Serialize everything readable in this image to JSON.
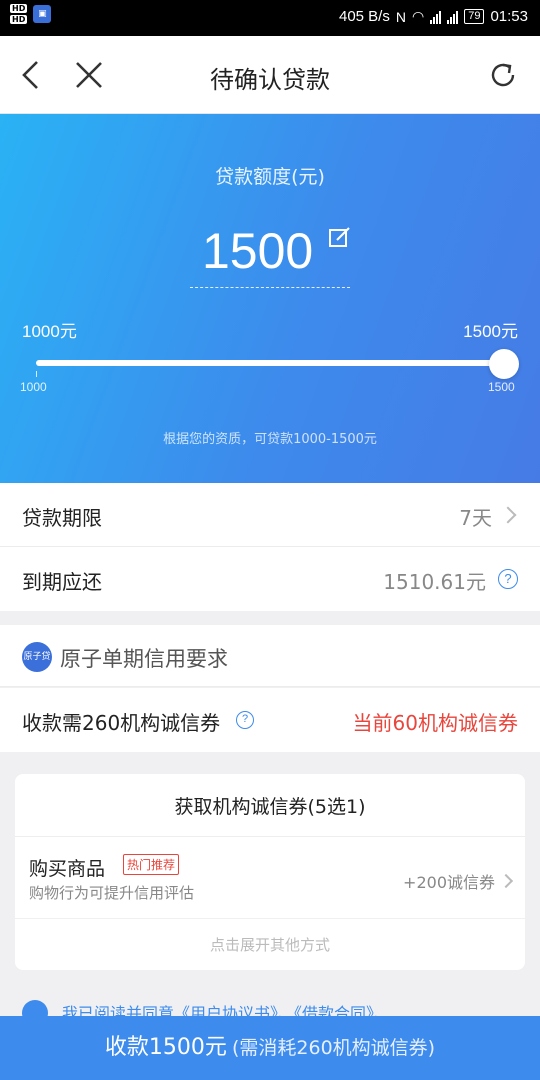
{
  "status_bar": {
    "hd1": "HD",
    "hd2": "HD",
    "net_speed": "405 B/s",
    "battery": "79",
    "time": "01:53"
  },
  "header": {
    "title": "待确认贷款",
    "icons": [
      "back-icon",
      "close-icon",
      "refresh-icon"
    ]
  },
  "loan": {
    "label": "贷款额度(元)",
    "amount": "1500",
    "range_min_label": "1000元",
    "range_max_label": "1500元",
    "slider_min": "1000",
    "slider_max": "1500",
    "slider_fraction": 1.0,
    "hint": "根据您的资质，可贷款1000-1500元"
  },
  "term": {
    "label": "贷款期限",
    "value": "7天"
  },
  "due": {
    "label": "到期应还",
    "value": "1510.61元"
  },
  "credit": {
    "logo_text": "原子贷",
    "title": "原子单期信用要求",
    "requirement": "收款需260机构诚信券",
    "current": "当前60机构诚信券"
  },
  "coupon_card": {
    "title": "获取机构诚信券(5选1)",
    "option_title": "购买商品",
    "option_badge": "热门推荐",
    "option_subtitle": "购物行为可提升信用评估",
    "option_reward": "+200诚信券",
    "expand_text": "点击展开其他方式"
  },
  "agreement": {
    "text": "我已阅读并同意《用户协议书》、《借款合同》、"
  },
  "submit": {
    "main": "收款1500元",
    "sub": "(需消耗260机构诚信券)"
  },
  "colors": {
    "accent": "#3d8bec",
    "warning": "#e8453c"
  }
}
